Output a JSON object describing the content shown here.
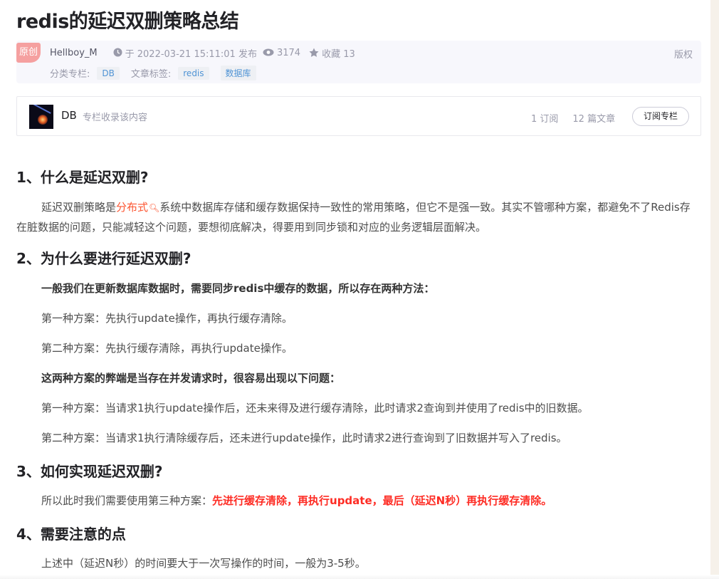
{
  "article": {
    "title": "redis的延迟双删策略总结",
    "badge": "原创",
    "author": "Hellboy_M",
    "publish_time": "于 2022-03-21 15:11:01 发布",
    "views": "3174",
    "favorites": "收藏 13",
    "copyright": "版权",
    "category_label": "分类专栏:",
    "category": "DB",
    "tags_label": "文章标签:",
    "tags": [
      "redis",
      "数据库"
    ]
  },
  "column": {
    "name": "DB",
    "subtitle": "专栏收录该内容",
    "subscribers": "1 订阅",
    "articles": "12 篇文章",
    "subscribe_button": "订阅专栏"
  },
  "content": {
    "h1": "1、什么是延迟双删?",
    "p1_pre": "延迟双删策略是",
    "p1_keyword": "分布式",
    "p1_post": "系统中数据库存储和缓存数据保持一致性的常用策略，但它不是强一致。其实不管哪种方案，都避免不了Redis存在脏数据的问题，只能减轻这个问题，要想彻底解决，得要用到同步锁和对应的业务逻辑层面解决。",
    "h2": "2、为什么要进行延迟双删?",
    "p2_bold": "一般我们在更新数据库数据时，需要同步redis中缓存的数据，所以存在两种方法：",
    "p2_a": "第一种方案：先执行update操作，再执行缓存清除。",
    "p2_b": "第二种方案：先执行缓存清除，再执行update操作。",
    "p2_bold2": "这两种方案的弊端是当存在并发请求时，很容易出现以下问题：",
    "p2_c": "第一种方案：当请求1执行update操作后，还未来得及进行缓存清除，此时请求2查询到并使用了redis中的旧数据。",
    "p2_d": "第二种方案：当请求1执行清除缓存后，还未进行update操作，此时请求2进行查询到了旧数据并写入了redis。",
    "h3": "3、如何实现延迟双删?",
    "p3_pre": "所以此时我们需要使用第三种方案：",
    "p3_red": "先进行缓存清除，再执行update，最后（延迟N秒）再执行缓存清除。",
    "h4": "4、需要注意的点",
    "p4": "上述中（延迟N秒）的时间要大于一次写操作的时间，一般为3-5秒。"
  },
  "colors": {
    "keyword": "#fc5531",
    "emphasis": "#fe2c24",
    "tag": "#5094d5"
  }
}
